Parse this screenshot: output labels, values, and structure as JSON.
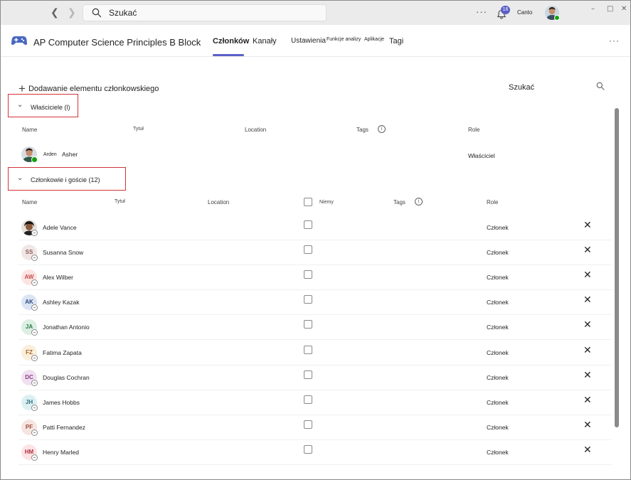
{
  "titlebar": {
    "search_text": "Szukać",
    "more": "···",
    "notification_count": "16",
    "org_name": "Canto"
  },
  "team": {
    "name": "AP Computer Science Principles B Block",
    "tabs": [
      {
        "label": "Członków",
        "active": true
      },
      {
        "label": "Kanały"
      },
      {
        "label": "Ustawienia"
      },
      {
        "label": "Funkcje analizy"
      },
      {
        "label": "Aplikacje"
      },
      {
        "label": "Tagi"
      }
    ],
    "more": "···"
  },
  "content": {
    "add_member_label": "Dodawanie elementu członkowskiego",
    "search_label": "Szukać",
    "owners_section_label": "Właściciele (l)",
    "members_section_label": "Członkowie i goście (12)"
  },
  "owner_columns": {
    "name": "Name",
    "title": "Tytuł",
    "location": "Location",
    "tags": "Tags",
    "role": "Role"
  },
  "owner": {
    "first_name": "Arden",
    "last_name": "Asher",
    "role": "Właściciel"
  },
  "member_columns": {
    "name": "Name",
    "title": "Tytuł",
    "location": "Location",
    "mute": "Niemy",
    "tags": "Tags",
    "role": "Role"
  },
  "members": [
    {
      "initials": "",
      "name": "Adele Vance",
      "role": "Członek",
      "photo": true,
      "bg": "#fde7e9",
      "fg": "#a4262c"
    },
    {
      "initials": "SS",
      "name": "Susanna Snow",
      "role": "Członek",
      "bg": "#f1e6e6",
      "fg": "#8b5a5a"
    },
    {
      "initials": "AW",
      "name": "Alex Wilber",
      "role": "Członek",
      "bg": "#fde3e1",
      "fg": "#c0504d"
    },
    {
      "initials": "AK",
      "name": "Ashley Kazak",
      "role": "Członek",
      "bg": "#dbe4f3",
      "fg": "#2e4a7d"
    },
    {
      "initials": "JA",
      "name": "Jonathan Antonio",
      "role": "Członek",
      "bg": "#dcefe2",
      "fg": "#2b7a4b"
    },
    {
      "initials": "FZ",
      "name": "Fatima Zapata",
      "role": "Członek",
      "bg": "#fbeedb",
      "fg": "#a0642a"
    },
    {
      "initials": "DC",
      "name": "Douglas Cochran",
      "role": "Członek",
      "bg": "#f0e1f0",
      "fg": "#8a3d8a"
    },
    {
      "initials": "JH",
      "name": "James Hobbs",
      "role": "Członek",
      "bg": "#dcf0f2",
      "fg": "#2b6f7a"
    },
    {
      "initials": "PF",
      "name": "Patti Fernandez",
      "role": "Członek",
      "bg": "#f6e4e0",
      "fg": "#9a4d3a"
    },
    {
      "initials": "HM",
      "name": "Henry Marled",
      "role": "Członek",
      "bg": "#fde3e5",
      "fg": "#b0323f"
    }
  ],
  "colors": {
    "accent": "#5b5fc7",
    "highlight_border": "#d13438",
    "presence_green": "#13a10e"
  }
}
